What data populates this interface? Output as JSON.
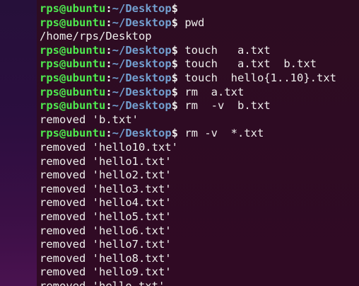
{
  "terminal": {
    "prompt": {
      "user_host": "rps@ubuntu",
      "colon": ":",
      "path": "~/Desktop",
      "dollar": "$"
    },
    "lines": [
      {
        "type": "prompt",
        "command": ""
      },
      {
        "type": "prompt",
        "command": " pwd"
      },
      {
        "type": "output",
        "text": "/home/rps/Desktop"
      },
      {
        "type": "prompt",
        "command": " touch   a.txt"
      },
      {
        "type": "prompt",
        "command": " touch   a.txt  b.txt"
      },
      {
        "type": "prompt",
        "command": " touch  hello{1..10}.txt"
      },
      {
        "type": "prompt",
        "command": " rm  a.txt"
      },
      {
        "type": "prompt",
        "command": " rm  -v  b.txt"
      },
      {
        "type": "output",
        "text": "removed 'b.txt'"
      },
      {
        "type": "prompt",
        "command": " rm -v  *.txt"
      },
      {
        "type": "output",
        "text": "removed 'hello10.txt'"
      },
      {
        "type": "output",
        "text": "removed 'hello1.txt'"
      },
      {
        "type": "output",
        "text": "removed 'hello2.txt'"
      },
      {
        "type": "output",
        "text": "removed 'hello3.txt'"
      },
      {
        "type": "output",
        "text": "removed 'hello4.txt'"
      },
      {
        "type": "output",
        "text": "removed 'hello5.txt'"
      },
      {
        "type": "output",
        "text": "removed 'hello6.txt'"
      },
      {
        "type": "output",
        "text": "removed 'hello7.txt'"
      },
      {
        "type": "output",
        "text": "removed 'hello8.txt'"
      },
      {
        "type": "output",
        "text": "removed 'hello9.txt'"
      },
      {
        "type": "output",
        "text": "removed 'hello.txt'"
      }
    ]
  },
  "colors": {
    "background": "#300a24",
    "prompt_user": "#4ee94e",
    "prompt_path": "#729fcf",
    "text": "#eeeeec"
  }
}
